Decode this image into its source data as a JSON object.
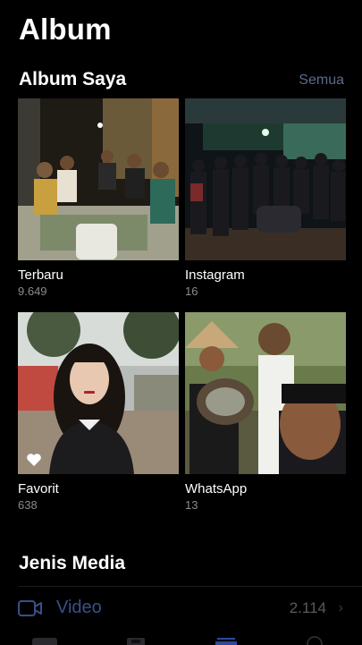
{
  "header": {
    "title": "Album"
  },
  "my_albums": {
    "title": "Album Saya",
    "see_all": "Semua",
    "items": [
      {
        "name": "Terbaru",
        "count": "9.649"
      },
      {
        "name": "Instagram",
        "count": "16"
      },
      {
        "name": "Favorit",
        "count": "638"
      },
      {
        "name": "WhatsApp",
        "count": "13"
      }
    ]
  },
  "media_types": {
    "title": "Jenis Media",
    "rows": [
      {
        "label": "Video",
        "count": "2.114",
        "icon": "video-icon"
      }
    ]
  },
  "tabbar": {
    "icons": [
      "photos-icon",
      "for-you-icon",
      "albums-icon",
      "search-icon"
    ]
  },
  "colors": {
    "background": "#000000",
    "accent": "#3a4f8a",
    "secondary_text": "#8a8a8e"
  }
}
